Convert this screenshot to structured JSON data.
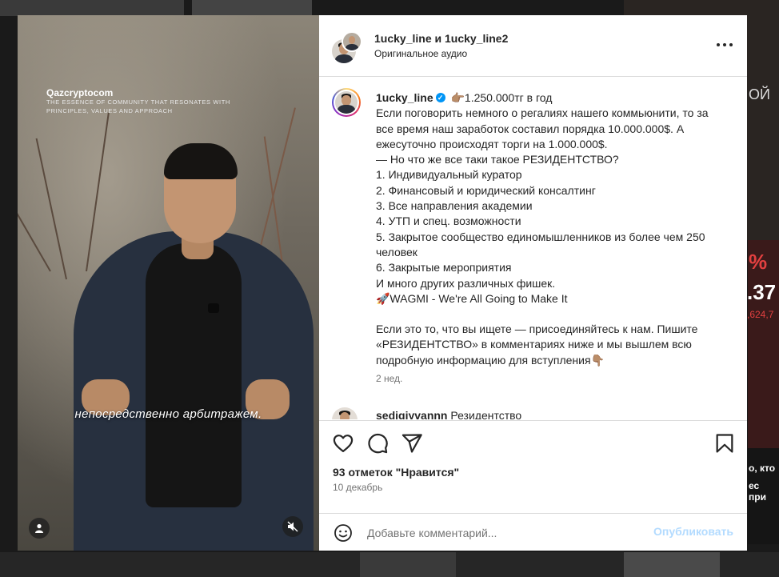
{
  "background": {
    "side_text_1": "ОЙ",
    "side_text_2": "%",
    "side_text_3": ".37",
    "side_text_4": ",624,7",
    "side_text_5": "о, кто",
    "side_text_6": "ес при"
  },
  "video": {
    "brand": "Qazcryptocom",
    "tagline": "THE ESSENCE OF COMMUNITY THAT RESONATES WITH PRINCIPLES, VALUES AND APPROACH",
    "subtitle": "непосредственно арбитражем.",
    "user_icon": "user-icon",
    "mute_icon": "muted-speaker-icon"
  },
  "header": {
    "names": "1ucky_line и 1ucky_line2",
    "audio": "Оригинальное аудио",
    "more_icon": "more-options-icon"
  },
  "caption": {
    "username": "1ucky_line",
    "verified": "✓",
    "lines": [
      "👉🏽1.250.000тг в год",
      "Если поговорить немного о регалиях нашего коммьюнити, то за все время наш заработок составил порядка 10.000.000$. А ежесуточно происходят торги на 1.000.000$.",
      "— Но что же все таки такое РЕЗИДЕНТСТВО?",
      "1. Индивидуальный куратор",
      "2. Финансовый и юридический консалтинг",
      "3. Все направления академии",
      "4. УТП и спец. возможности",
      "5. Закрытое сообщество единомышленников из более чем 250 человек",
      "6. Закрытые мероприятия",
      "И много других различных фишек.",
      "🚀WAGMI - We're All Going to Make It"
    ],
    "cta": "Если это то, что вы ищете — присоединяйтесь к нам. Пишите «РЕЗИДЕНТСТВО» в комментариях ниже и мы вышлем всю подробную информацию для вступления👇🏽",
    "time": "2 нед."
  },
  "comment": {
    "username": "sedigiyvannn",
    "text": "Резидентство"
  },
  "actions": {
    "like_icon": "heart-icon",
    "comment_icon": "comment-icon",
    "share_icon": "share-icon",
    "save_icon": "bookmark-icon"
  },
  "likes": "93 отметок \"Нравится\"",
  "date": "10 декабрь",
  "comment_input": {
    "placeholder": "Добавьте комментарий...",
    "emoji_icon": "emoji-icon",
    "publish_label": "Опубликовать"
  }
}
